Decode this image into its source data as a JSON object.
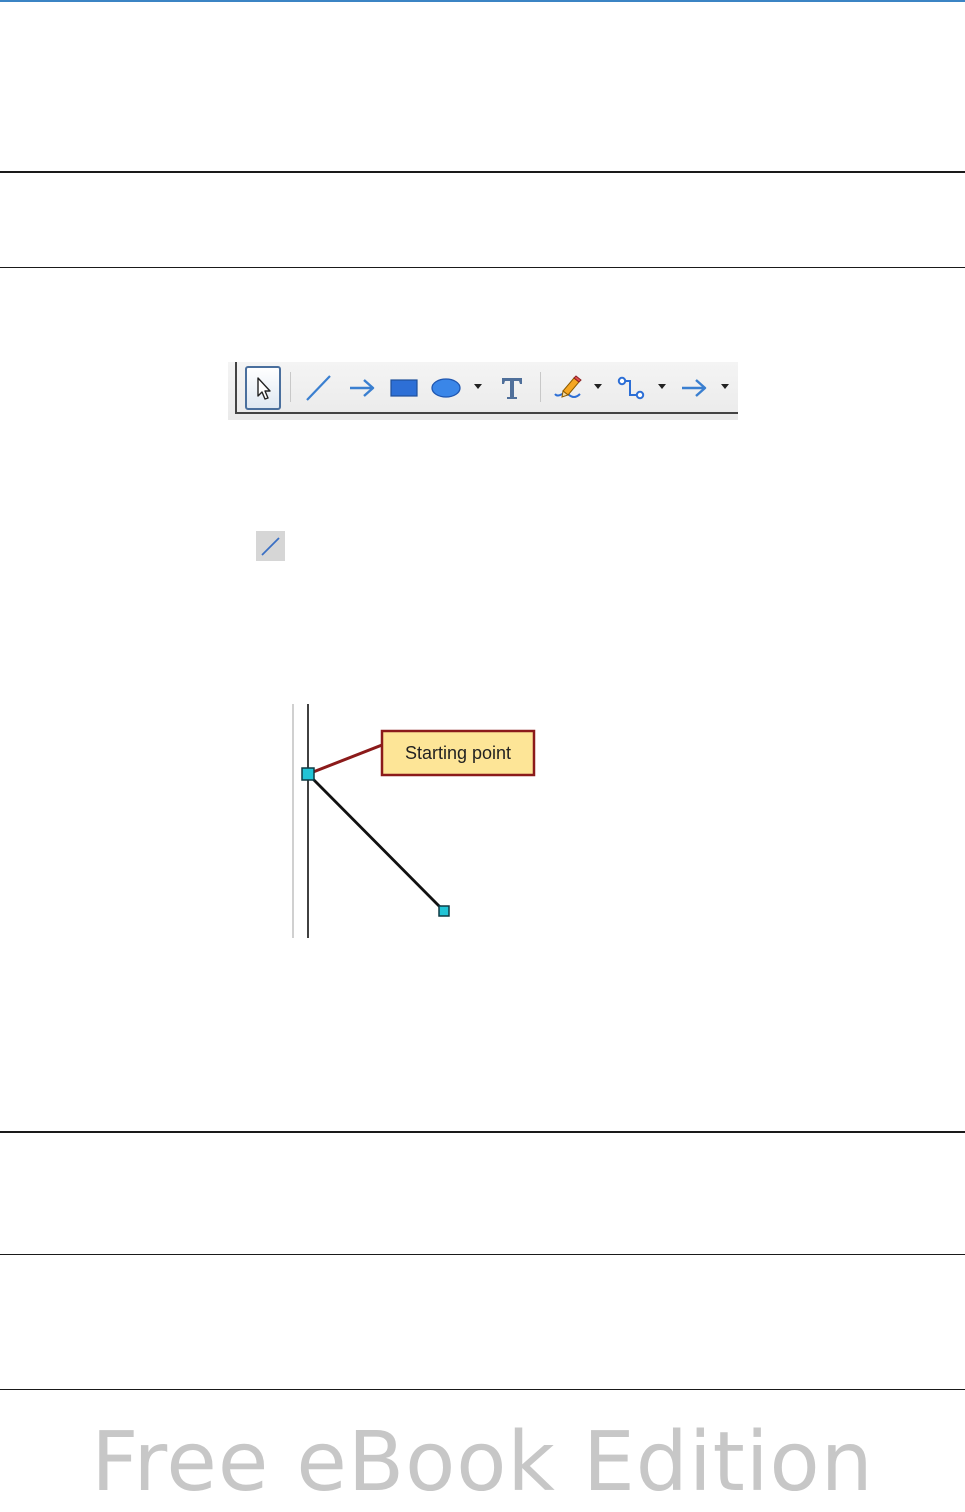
{
  "toolbar": {
    "buttons": [
      {
        "name": "select",
        "icon": "pointer-arrow-icon",
        "selected": true
      },
      {
        "name": "line",
        "icon": "line-icon"
      },
      {
        "name": "line-ends-with-arrow",
        "icon": "arrow-right-icon"
      },
      {
        "name": "rectangle",
        "icon": "rectangle-icon"
      },
      {
        "name": "ellipse",
        "icon": "ellipse-icon"
      },
      {
        "name": "text",
        "icon": "text-t-icon"
      },
      {
        "name": "freeform-line",
        "icon": "freeform-pencil-icon"
      },
      {
        "name": "connector",
        "icon": "connector-icon"
      },
      {
        "name": "lines-and-arrows",
        "icon": "arrow-right-icon"
      }
    ]
  },
  "inline_icon": {
    "icon": "line-icon"
  },
  "diagram": {
    "callout_label": "Starting point",
    "colors": {
      "callout_fill": "#fde597",
      "callout_border": "#8b1a1a",
      "handle_fill": "#21c4d6",
      "line": "#111111"
    }
  },
  "watermark": {
    "text": "Free eBook Edition"
  }
}
